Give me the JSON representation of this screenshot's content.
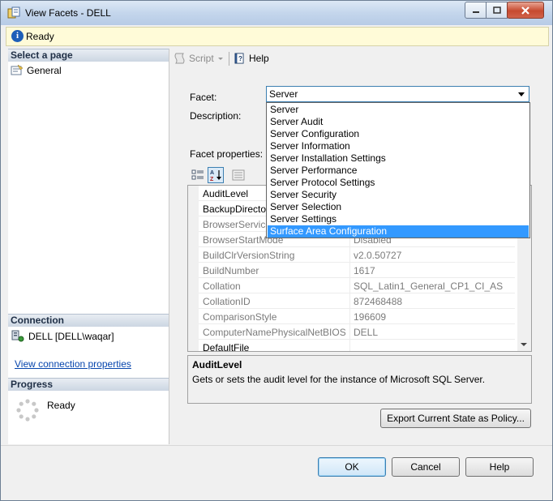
{
  "window": {
    "title": "View Facets - DELL",
    "controls": [
      "minimize-icon",
      "maximize-icon",
      "close-icon"
    ]
  },
  "status": {
    "icon": "info-icon",
    "text": "Ready"
  },
  "left_pane": {
    "select_page_header": "Select a page",
    "pages": [
      {
        "label": "General",
        "icon": "page-icon"
      }
    ],
    "connection_header": "Connection",
    "connection_server": "DELL [DELL\\waqar]",
    "connection_link": "View connection properties",
    "progress_header": "Progress",
    "progress_status": "Ready"
  },
  "toolbar": {
    "script_label": "Script",
    "help_label": "Help"
  },
  "form": {
    "facet_label": "Facet:",
    "facet_value": "Server",
    "description_label": "Description:",
    "facet_properties_label": "Facet properties:"
  },
  "dropdown": {
    "options": [
      "Server",
      "Server Audit",
      "Server Configuration",
      "Server Information",
      "Server Installation Settings",
      "Server Performance",
      "Server Protocol Settings",
      "Server Security",
      "Server Selection",
      "Server Settings",
      "Surface Area Configuration"
    ],
    "highlighted": "Surface Area Configuration"
  },
  "properties": [
    {
      "name": "AuditLevel",
      "value": "",
      "disabled": false
    },
    {
      "name": "BackupDirectory",
      "value": "",
      "disabled": false
    },
    {
      "name": "BrowserServiceAccount",
      "value": "",
      "disabled": true
    },
    {
      "name": "BrowserStartMode",
      "value": "Disabled",
      "disabled": true
    },
    {
      "name": "BuildClrVersionString",
      "value": "v2.0.50727",
      "disabled": true
    },
    {
      "name": "BuildNumber",
      "value": "1617",
      "disabled": true
    },
    {
      "name": "Collation",
      "value": "SQL_Latin1_General_CP1_CI_AS",
      "disabled": true
    },
    {
      "name": "CollationID",
      "value": "872468488",
      "disabled": true
    },
    {
      "name": "ComparisonStyle",
      "value": "196609",
      "disabled": true
    },
    {
      "name": "ComputerNamePhysicalNetBIOS",
      "value": "DELL",
      "disabled": true
    },
    {
      "name": "DefaultFile",
      "value": "",
      "disabled": false
    }
  ],
  "description_panel": {
    "title": "AuditLevel",
    "text": "Gets or sets the audit level for the instance of Microsoft SQL Server."
  },
  "buttons": {
    "export": "Export Current State as Policy...",
    "ok": "OK",
    "cancel": "Cancel",
    "help": "Help"
  }
}
